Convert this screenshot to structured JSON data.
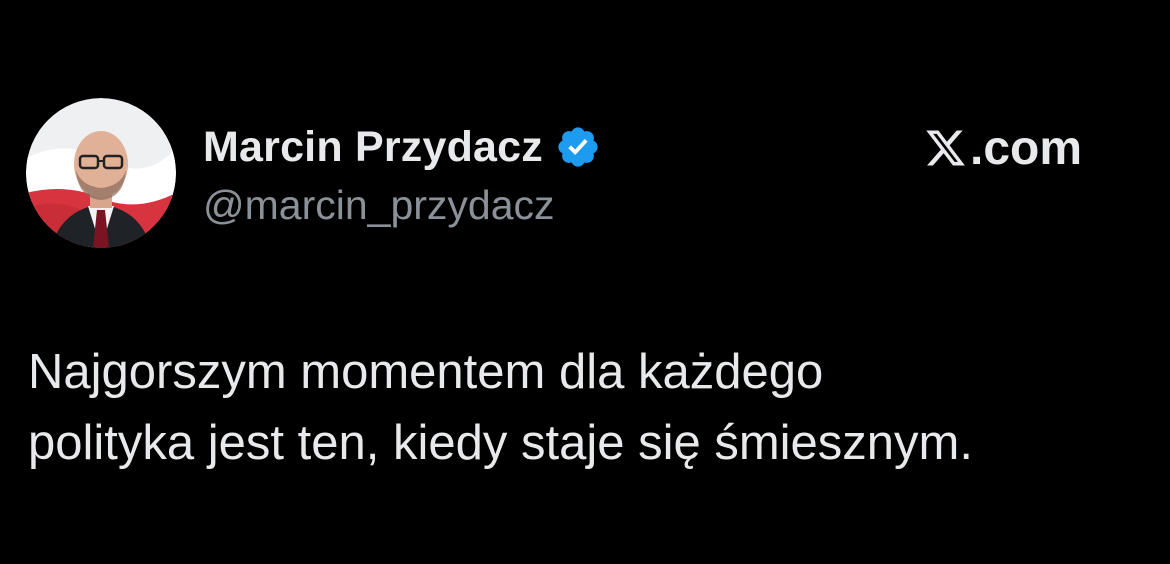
{
  "tweet": {
    "author": {
      "name": "Marcin Przydacz",
      "handle": "@marcin_przydacz",
      "verified": true,
      "verified_badge_icon": "verified-badge-icon",
      "verified_color": "#1d9bf0"
    },
    "brand": {
      "logo_icon": "x-logo-icon",
      "domain": ".com"
    },
    "text": "Najgorszym momentem dla każdego\npolityka jest ten, kiedy staje się śmiesznym."
  },
  "colors": {
    "background": "#000000",
    "primary_text": "#e7e9ea",
    "secondary_text": "#8b9198",
    "verified_blue": "#1d9bf0"
  }
}
